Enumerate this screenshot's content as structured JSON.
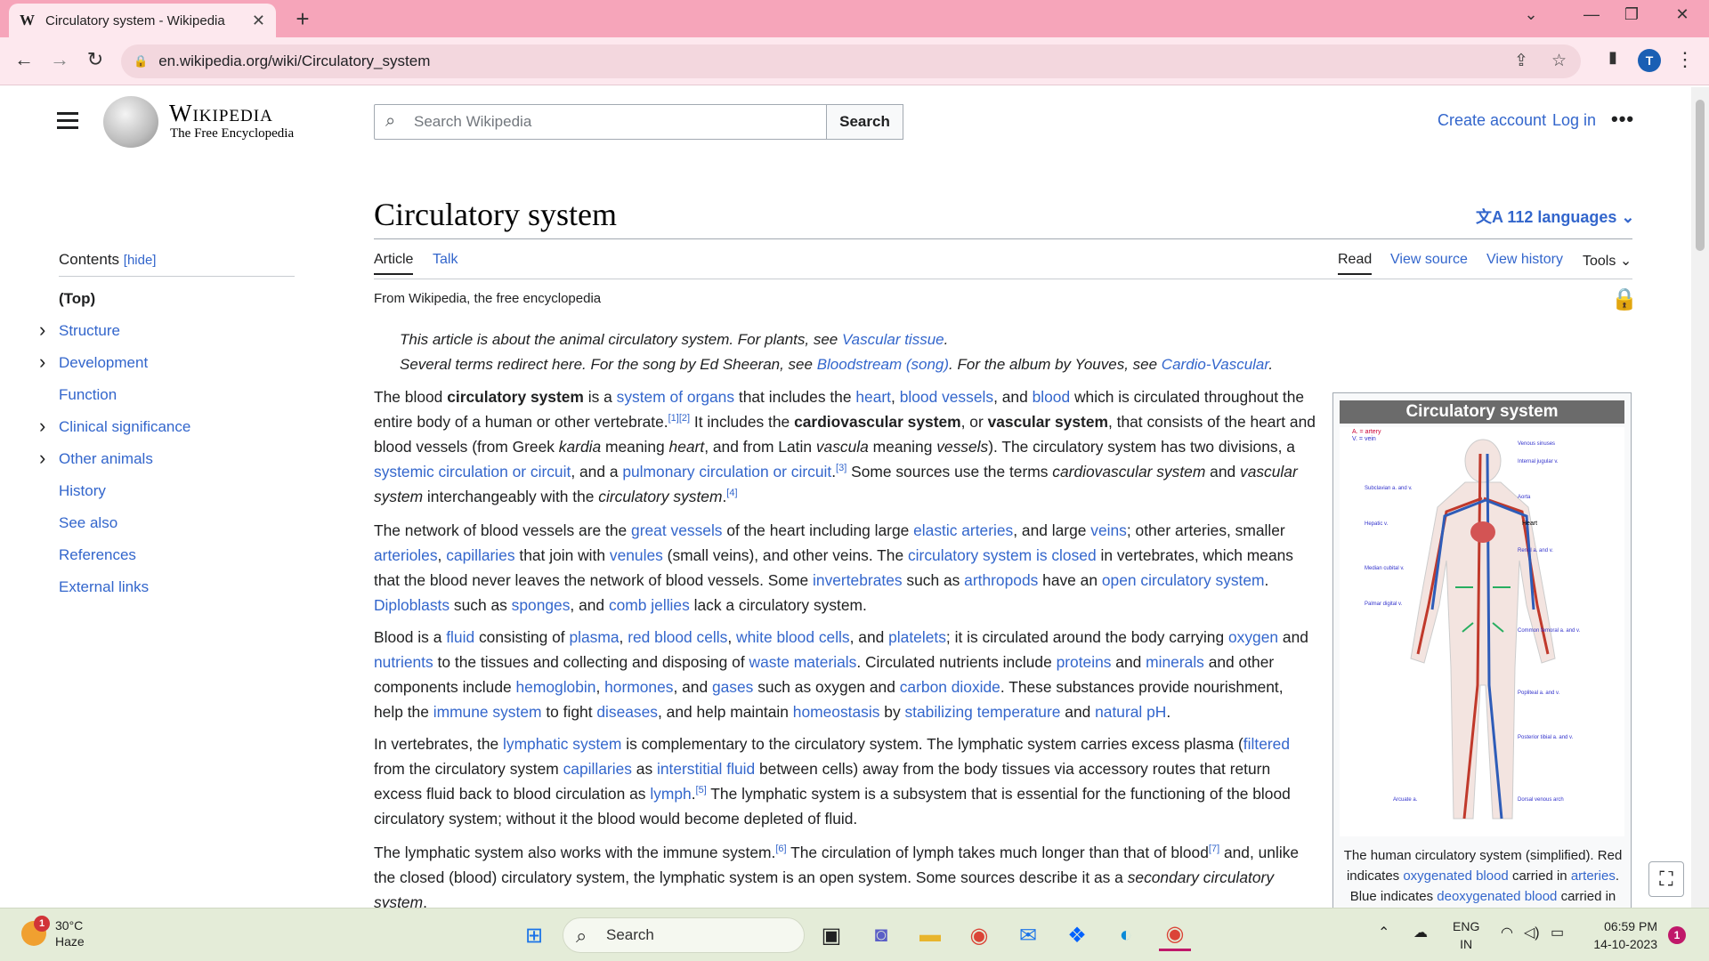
{
  "browser": {
    "tab_title": "Circulatory system - Wikipedia",
    "tab_favicon": "W",
    "url": "en.wikipedia.org/wiki/Circulatory_system",
    "profile_initial": "T"
  },
  "wiki": {
    "wordmark": "Wikipedia",
    "tagline": "The Free Encyclopedia",
    "search_placeholder": "Search Wikipedia",
    "search_button": "Search",
    "create_account": "Create account",
    "log_in": "Log in",
    "more": "•••"
  },
  "article": {
    "title": "Circulatory system",
    "languages": "112 languages",
    "tab_article": "Article",
    "tab_talk": "Talk",
    "read": "Read",
    "view_source": "View source",
    "view_history": "View history",
    "tools": "Tools",
    "from": "From Wikipedia, the free encyclopedia",
    "hatnote1_pre": "This article is about the animal circulatory system. For plants, see ",
    "hatnote1_link": "Vascular tissue",
    "hatnote1_post": ".",
    "hatnote2_pre": "Several terms redirect here. For the song by Ed Sheeran, see ",
    "hatnote2_link": "Bloodstream (song)",
    "hatnote2_mid": ". For the album by Youves, see ",
    "hatnote2_link2": "Cardio-Vascular",
    "hatnote2_post": "."
  },
  "toc": {
    "heading": "Contents",
    "hide": "[hide]",
    "items": [
      {
        "label": "(Top)",
        "chevron": false
      },
      {
        "label": "Structure",
        "chevron": true
      },
      {
        "label": "Development",
        "chevron": true
      },
      {
        "label": "Function",
        "chevron": false
      },
      {
        "label": "Clinical significance",
        "chevron": true
      },
      {
        "label": "Other animals",
        "chevron": true
      },
      {
        "label": "History",
        "chevron": false
      },
      {
        "label": "See also",
        "chevron": false
      },
      {
        "label": "References",
        "chevron": false
      },
      {
        "label": "External links",
        "chevron": false
      }
    ]
  },
  "infobox": {
    "title": "Circulatory system",
    "legend_a": "A. = artery",
    "legend_v": "V. = vein",
    "heart_label": "Heart",
    "caption_1": "The human circulatory system (simplified). Red indicates ",
    "caption_link1": "oxygenated blood",
    "caption_2": " carried in ",
    "caption_link2": "arteries",
    "caption_3": ". Blue indicates ",
    "caption_link3": "deoxygenated blood",
    "caption_4": " carried in"
  },
  "taskbar": {
    "temp": "30°C",
    "weather": "Haze",
    "weather_badge": "1",
    "search": "Search",
    "lang1": "ENG",
    "lang2": "IN",
    "time": "06:59 PM",
    "date": "14-10-2023",
    "notifications": "1"
  },
  "colors": {
    "link": "#3366cc",
    "tab_strip": "#f6a5ba",
    "taskbar": "#e4ecd8"
  }
}
